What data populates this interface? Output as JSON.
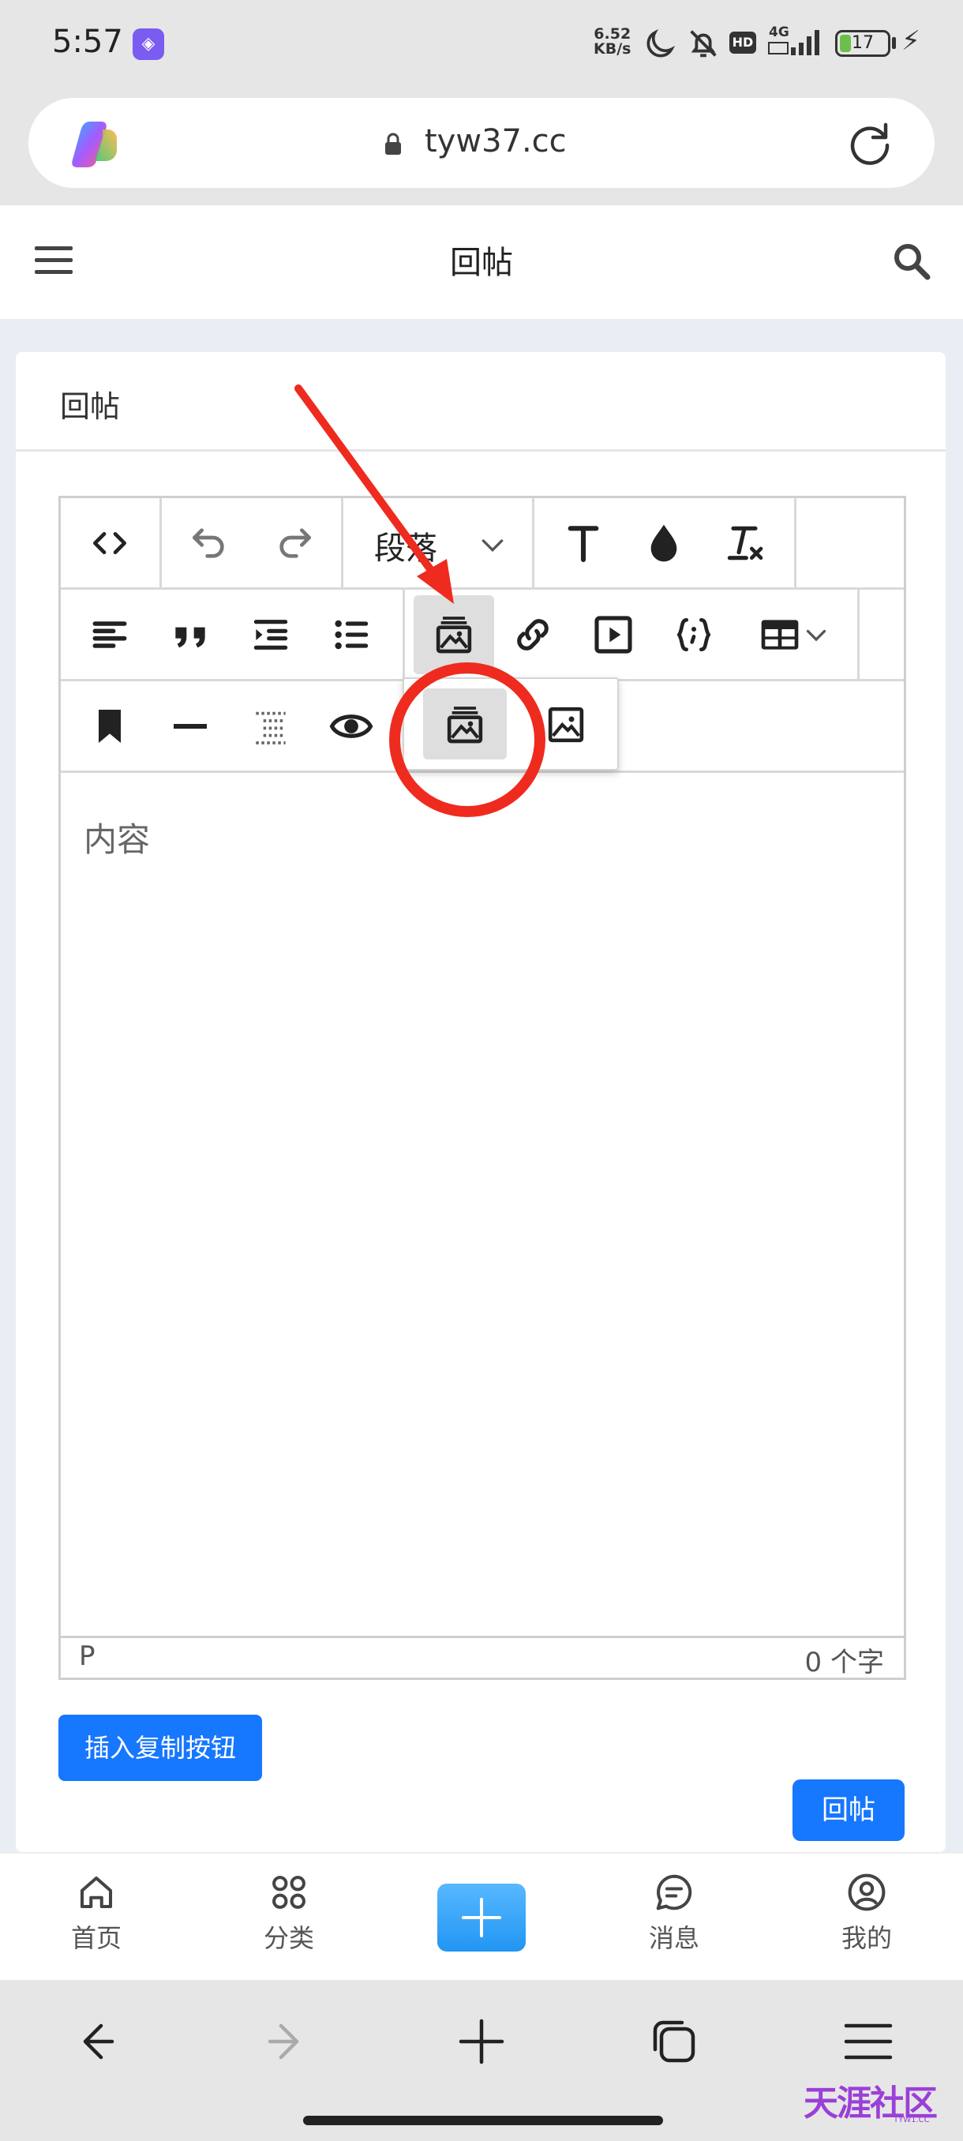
{
  "status_bar": {
    "time": "5:57",
    "speed_value": "6.52",
    "speed_unit": "KB/s",
    "network": "4G",
    "hd": "HD",
    "battery": "17"
  },
  "browser": {
    "url": "tyw37.cc"
  },
  "header": {
    "title": "回帖"
  },
  "card": {
    "title": "回帖"
  },
  "editor": {
    "paragraph_select": "段落",
    "content_placeholder": "内容",
    "element_path": "P",
    "word_count": "0 个字"
  },
  "buttons": {
    "insert_copy": "插入复制按钮",
    "reply": "回帖"
  },
  "tabs": [
    {
      "label": "首页",
      "icon": "home-icon"
    },
    {
      "label": "分类",
      "icon": "grid-icon"
    },
    {
      "label": "",
      "icon": "plus-icon"
    },
    {
      "label": "消息",
      "icon": "chat-icon"
    },
    {
      "label": "我的",
      "icon": "user-icon"
    }
  ],
  "watermark": {
    "text": "天涯社区",
    "sub": "TYW1.CC"
  },
  "colors": {
    "primary": "#1677ff",
    "annotation": "#ee2b1e"
  }
}
